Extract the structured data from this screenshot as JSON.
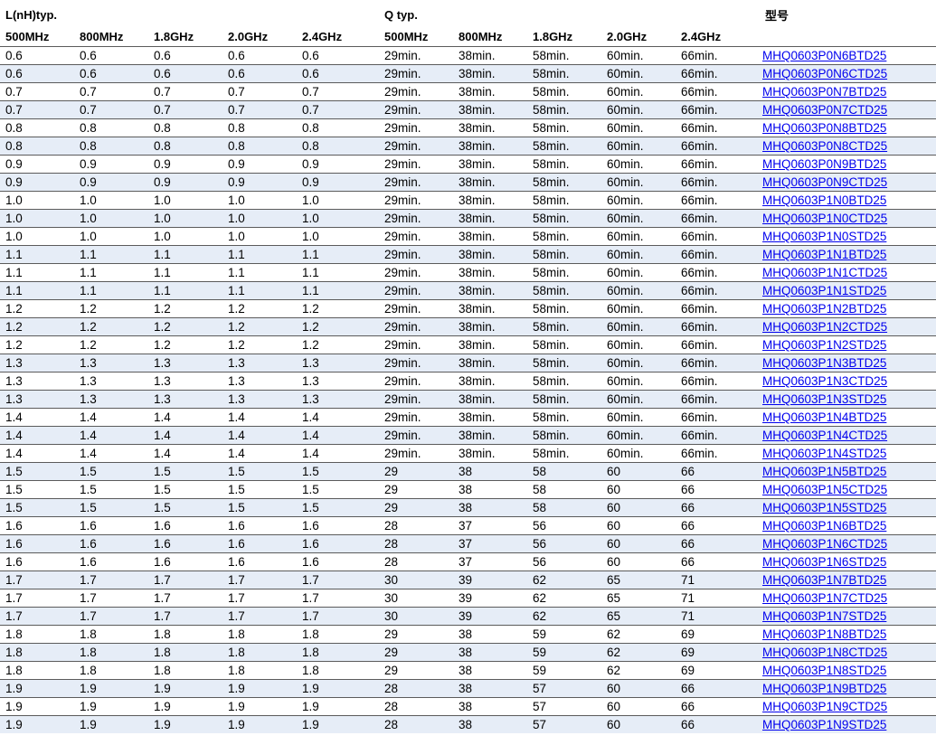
{
  "header": {
    "l_group": "L(nH)typ.",
    "q_group": "Q typ.",
    "pn_group": "型号",
    "l_freqs": [
      "500MHz",
      "800MHz",
      "1.8GHz",
      "2.0GHz",
      "2.4GHz"
    ],
    "q_freqs": [
      "500MHz",
      "800MHz",
      "1.8GHz",
      "2.0GHz",
      "2.4GHz"
    ]
  },
  "rows": [
    {
      "l": [
        "0.6",
        "0.6",
        "0.6",
        "0.6",
        "0.6"
      ],
      "q": [
        "29min.",
        "38min.",
        "58min.",
        "60min.",
        "66min."
      ],
      "pn": "MHQ0603P0N6BTD25"
    },
    {
      "l": [
        "0.6",
        "0.6",
        "0.6",
        "0.6",
        "0.6"
      ],
      "q": [
        "29min.",
        "38min.",
        "58min.",
        "60min.",
        "66min."
      ],
      "pn": "MHQ0603P0N6CTD25"
    },
    {
      "l": [
        "0.7",
        "0.7",
        "0.7",
        "0.7",
        "0.7"
      ],
      "q": [
        "29min.",
        "38min.",
        "58min.",
        "60min.",
        "66min."
      ],
      "pn": "MHQ0603P0N7BTD25"
    },
    {
      "l": [
        "0.7",
        "0.7",
        "0.7",
        "0.7",
        "0.7"
      ],
      "q": [
        "29min.",
        "38min.",
        "58min.",
        "60min.",
        "66min."
      ],
      "pn": "MHQ0603P0N7CTD25"
    },
    {
      "l": [
        "0.8",
        "0.8",
        "0.8",
        "0.8",
        "0.8"
      ],
      "q": [
        "29min.",
        "38min.",
        "58min.",
        "60min.",
        "66min."
      ],
      "pn": "MHQ0603P0N8BTD25"
    },
    {
      "l": [
        "0.8",
        "0.8",
        "0.8",
        "0.8",
        "0.8"
      ],
      "q": [
        "29min.",
        "38min.",
        "58min.",
        "60min.",
        "66min."
      ],
      "pn": "MHQ0603P0N8CTD25"
    },
    {
      "l": [
        "0.9",
        "0.9",
        "0.9",
        "0.9",
        "0.9"
      ],
      "q": [
        "29min.",
        "38min.",
        "58min.",
        "60min.",
        "66min."
      ],
      "pn": "MHQ0603P0N9BTD25"
    },
    {
      "l": [
        "0.9",
        "0.9",
        "0.9",
        "0.9",
        "0.9"
      ],
      "q": [
        "29min.",
        "38min.",
        "58min.",
        "60min.",
        "66min."
      ],
      "pn": "MHQ0603P0N9CTD25"
    },
    {
      "l": [
        "1.0",
        "1.0",
        "1.0",
        "1.0",
        "1.0"
      ],
      "q": [
        "29min.",
        "38min.",
        "58min.",
        "60min.",
        "66min."
      ],
      "pn": "MHQ0603P1N0BTD25"
    },
    {
      "l": [
        "1.0",
        "1.0",
        "1.0",
        "1.0",
        "1.0"
      ],
      "q": [
        "29min.",
        "38min.",
        "58min.",
        "60min.",
        "66min."
      ],
      "pn": "MHQ0603P1N0CTD25"
    },
    {
      "l": [
        "1.0",
        "1.0",
        "1.0",
        "1.0",
        "1.0"
      ],
      "q": [
        "29min.",
        "38min.",
        "58min.",
        "60min.",
        "66min."
      ],
      "pn": "MHQ0603P1N0STD25"
    },
    {
      "l": [
        "1.1",
        "1.1",
        "1.1",
        "1.1",
        "1.1"
      ],
      "q": [
        "29min.",
        "38min.",
        "58min.",
        "60min.",
        "66min."
      ],
      "pn": "MHQ0603P1N1BTD25"
    },
    {
      "l": [
        "1.1",
        "1.1",
        "1.1",
        "1.1",
        "1.1"
      ],
      "q": [
        "29min.",
        "38min.",
        "58min.",
        "60min.",
        "66min."
      ],
      "pn": "MHQ0603P1N1CTD25"
    },
    {
      "l": [
        "1.1",
        "1.1",
        "1.1",
        "1.1",
        "1.1"
      ],
      "q": [
        "29min.",
        "38min.",
        "58min.",
        "60min.",
        "66min."
      ],
      "pn": "MHQ0603P1N1STD25"
    },
    {
      "l": [
        "1.2",
        "1.2",
        "1.2",
        "1.2",
        "1.2"
      ],
      "q": [
        "29min.",
        "38min.",
        "58min.",
        "60min.",
        "66min."
      ],
      "pn": "MHQ0603P1N2BTD25"
    },
    {
      "l": [
        "1.2",
        "1.2",
        "1.2",
        "1.2",
        "1.2"
      ],
      "q": [
        "29min.",
        "38min.",
        "58min.",
        "60min.",
        "66min."
      ],
      "pn": "MHQ0603P1N2CTD25"
    },
    {
      "l": [
        "1.2",
        "1.2",
        "1.2",
        "1.2",
        "1.2"
      ],
      "q": [
        "29min.",
        "38min.",
        "58min.",
        "60min.",
        "66min."
      ],
      "pn": "MHQ0603P1N2STD25"
    },
    {
      "l": [
        "1.3",
        "1.3",
        "1.3",
        "1.3",
        "1.3"
      ],
      "q": [
        "29min.",
        "38min.",
        "58min.",
        "60min.",
        "66min."
      ],
      "pn": "MHQ0603P1N3BTD25"
    },
    {
      "l": [
        "1.3",
        "1.3",
        "1.3",
        "1.3",
        "1.3"
      ],
      "q": [
        "29min.",
        "38min.",
        "58min.",
        "60min.",
        "66min."
      ],
      "pn": "MHQ0603P1N3CTD25"
    },
    {
      "l": [
        "1.3",
        "1.3",
        "1.3",
        "1.3",
        "1.3"
      ],
      "q": [
        "29min.",
        "38min.",
        "58min.",
        "60min.",
        "66min."
      ],
      "pn": "MHQ0603P1N3STD25"
    },
    {
      "l": [
        "1.4",
        "1.4",
        "1.4",
        "1.4",
        "1.4"
      ],
      "q": [
        "29min.",
        "38min.",
        "58min.",
        "60min.",
        "66min."
      ],
      "pn": "MHQ0603P1N4BTD25"
    },
    {
      "l": [
        "1.4",
        "1.4",
        "1.4",
        "1.4",
        "1.4"
      ],
      "q": [
        "29min.",
        "38min.",
        "58min.",
        "60min.",
        "66min."
      ],
      "pn": "MHQ0603P1N4CTD25"
    },
    {
      "l": [
        "1.4",
        "1.4",
        "1.4",
        "1.4",
        "1.4"
      ],
      "q": [
        "29min.",
        "38min.",
        "58min.",
        "60min.",
        "66min."
      ],
      "pn": "MHQ0603P1N4STD25"
    },
    {
      "l": [
        "1.5",
        "1.5",
        "1.5",
        "1.5",
        "1.5"
      ],
      "q": [
        "29",
        "38",
        "58",
        "60",
        "66"
      ],
      "pn": "MHQ0603P1N5BTD25"
    },
    {
      "l": [
        "1.5",
        "1.5",
        "1.5",
        "1.5",
        "1.5"
      ],
      "q": [
        "29",
        "38",
        "58",
        "60",
        "66"
      ],
      "pn": "MHQ0603P1N5CTD25"
    },
    {
      "l": [
        "1.5",
        "1.5",
        "1.5",
        "1.5",
        "1.5"
      ],
      "q": [
        "29",
        "38",
        "58",
        "60",
        "66"
      ],
      "pn": "MHQ0603P1N5STD25"
    },
    {
      "l": [
        "1.6",
        "1.6",
        "1.6",
        "1.6",
        "1.6"
      ],
      "q": [
        "28",
        "37",
        "56",
        "60",
        "66"
      ],
      "pn": "MHQ0603P1N6BTD25"
    },
    {
      "l": [
        "1.6",
        "1.6",
        "1.6",
        "1.6",
        "1.6"
      ],
      "q": [
        "28",
        "37",
        "56",
        "60",
        "66"
      ],
      "pn": "MHQ0603P1N6CTD25"
    },
    {
      "l": [
        "1.6",
        "1.6",
        "1.6",
        "1.6",
        "1.6"
      ],
      "q": [
        "28",
        "37",
        "56",
        "60",
        "66"
      ],
      "pn": "MHQ0603P1N6STD25"
    },
    {
      "l": [
        "1.7",
        "1.7",
        "1.7",
        "1.7",
        "1.7"
      ],
      "q": [
        "30",
        "39",
        "62",
        "65",
        "71"
      ],
      "pn": "MHQ0603P1N7BTD25"
    },
    {
      "l": [
        "1.7",
        "1.7",
        "1.7",
        "1.7",
        "1.7"
      ],
      "q": [
        "30",
        "39",
        "62",
        "65",
        "71"
      ],
      "pn": "MHQ0603P1N7CTD25"
    },
    {
      "l": [
        "1.7",
        "1.7",
        "1.7",
        "1.7",
        "1.7"
      ],
      "q": [
        "30",
        "39",
        "62",
        "65",
        "71"
      ],
      "pn": "MHQ0603P1N7STD25"
    },
    {
      "l": [
        "1.8",
        "1.8",
        "1.8",
        "1.8",
        "1.8"
      ],
      "q": [
        "29",
        "38",
        "59",
        "62",
        "69"
      ],
      "pn": "MHQ0603P1N8BTD25"
    },
    {
      "l": [
        "1.8",
        "1.8",
        "1.8",
        "1.8",
        "1.8"
      ],
      "q": [
        "29",
        "38",
        "59",
        "62",
        "69"
      ],
      "pn": "MHQ0603P1N8CTD25"
    },
    {
      "l": [
        "1.8",
        "1.8",
        "1.8",
        "1.8",
        "1.8"
      ],
      "q": [
        "29",
        "38",
        "59",
        "62",
        "69"
      ],
      "pn": "MHQ0603P1N8STD25"
    },
    {
      "l": [
        "1.9",
        "1.9",
        "1.9",
        "1.9",
        "1.9"
      ],
      "q": [
        "28",
        "38",
        "57",
        "60",
        "66"
      ],
      "pn": "MHQ0603P1N9BTD25"
    },
    {
      "l": [
        "1.9",
        "1.9",
        "1.9",
        "1.9",
        "1.9"
      ],
      "q": [
        "28",
        "38",
        "57",
        "60",
        "66"
      ],
      "pn": "MHQ0603P1N9CTD25"
    },
    {
      "l": [
        "1.9",
        "1.9",
        "1.9",
        "1.9",
        "1.9"
      ],
      "q": [
        "28",
        "38",
        "57",
        "60",
        "66"
      ],
      "pn": "MHQ0603P1N9STD25"
    }
  ],
  "colors": {
    "stripe": "#e6edf7",
    "link": "#0000ee",
    "rule": "#5b5b5b"
  }
}
